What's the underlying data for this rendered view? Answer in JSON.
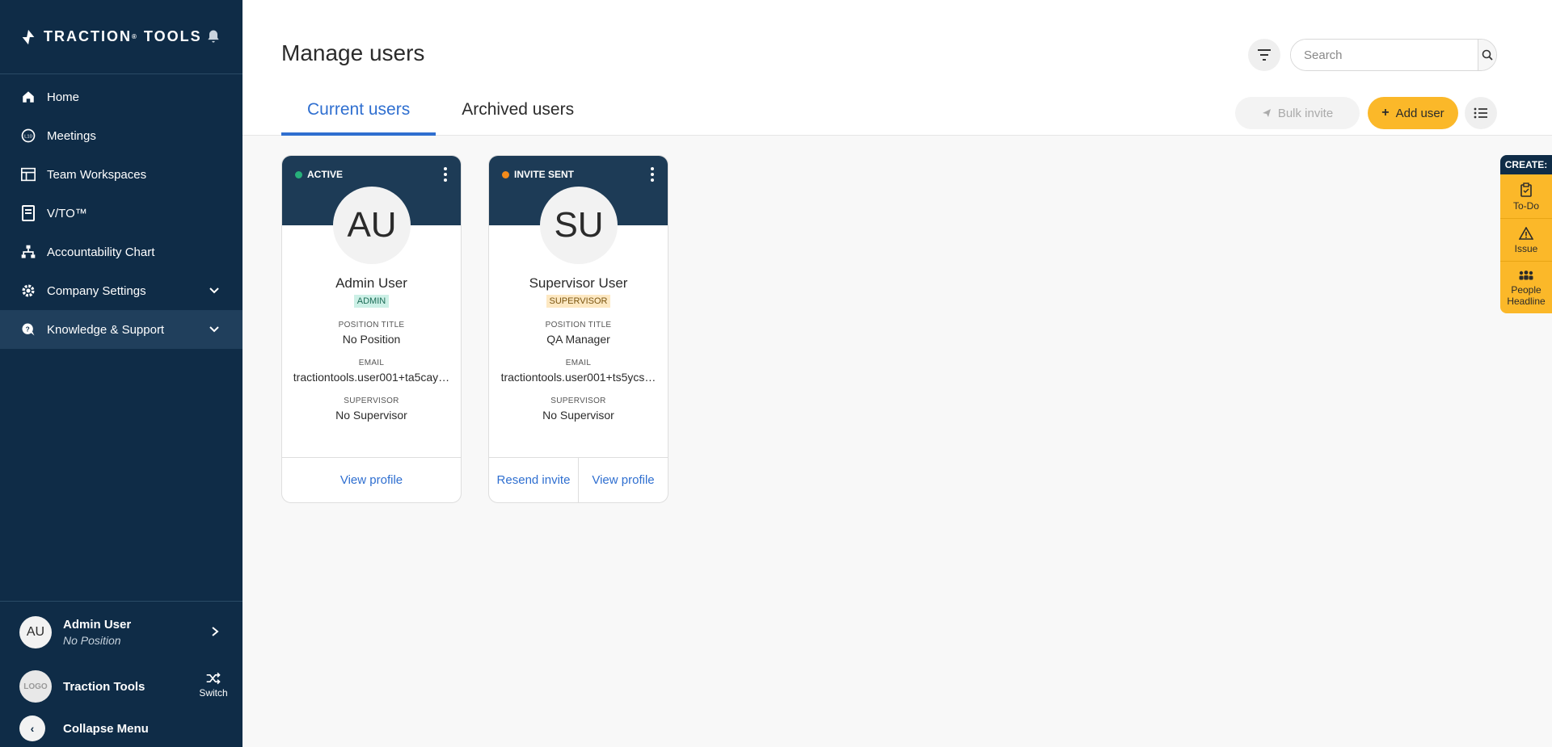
{
  "brand": {
    "name": "TRACTION",
    "reg": "®",
    "suffix": "TOOLS"
  },
  "nav": [
    {
      "label": "Home"
    },
    {
      "label": "Meetings"
    },
    {
      "label": "Team Workspaces"
    },
    {
      "label": "V/TO™"
    },
    {
      "label": "Accountability Chart"
    },
    {
      "label": "Company Settings"
    },
    {
      "label": "Knowledge & Support"
    }
  ],
  "current_user": {
    "initials": "AU",
    "name": "Admin User",
    "position": "No Position"
  },
  "company": {
    "logo_text": "LOGO",
    "name": "Traction Tools",
    "switch_label": "Switch"
  },
  "collapse_label": "Collapse Menu",
  "page": {
    "title": "Manage users"
  },
  "search": {
    "placeholder": "Search"
  },
  "tabs": [
    {
      "label": "Current users"
    },
    {
      "label": "Archived users"
    }
  ],
  "toolbar": {
    "bulk_invite": "Bulk invite",
    "add_user": "Add user"
  },
  "users": [
    {
      "status": "ACTIVE",
      "status_color": "#27b07a",
      "initials": "AU",
      "name": "Admin User",
      "role": "ADMIN",
      "position_label": "POSITION TITLE",
      "position": "No Position",
      "email_label": "EMAIL",
      "email": "tractiontools.user001+ta5cay…",
      "supervisor_label": "SUPERVISOR",
      "supervisor": "No Supervisor",
      "actions": [
        "View profile"
      ]
    },
    {
      "status": "INVITE SENT",
      "status_color": "#f28a1a",
      "initials": "SU",
      "name": "Supervisor User",
      "role": "SUPERVISOR",
      "position_label": "POSITION TITLE",
      "position": "QA Manager",
      "email_label": "EMAIL",
      "email": "tractiontools.user001+ts5ycs…",
      "supervisor_label": "SUPERVISOR",
      "supervisor": "No Supervisor",
      "actions": [
        "Resend invite",
        "View profile"
      ]
    }
  ],
  "create_panel": {
    "title": "CREATE:",
    "items": [
      {
        "label": "To-Do"
      },
      {
        "label": "Issue"
      },
      {
        "label": "People Headline"
      }
    ]
  },
  "colors": {
    "sidebar": "#0f2c47",
    "accent": "#2f6fd0",
    "cta": "#fbb829"
  }
}
